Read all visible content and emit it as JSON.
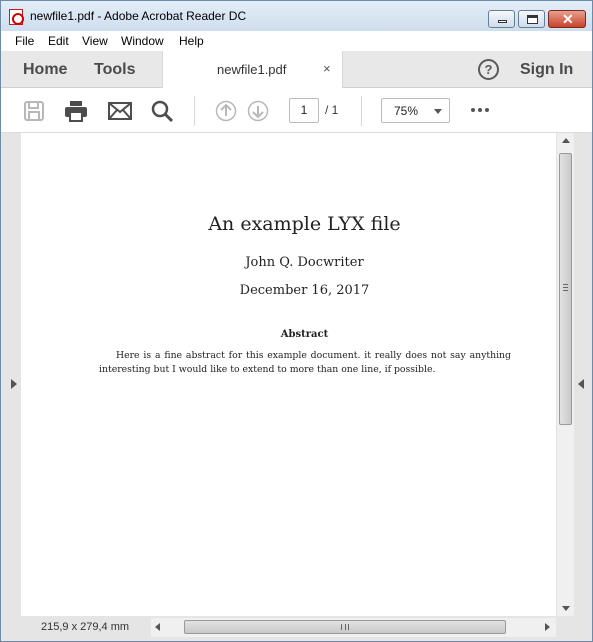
{
  "window": {
    "title": "newfile1.pdf - Adobe Acrobat Reader DC",
    "close_glyph": "✕"
  },
  "menu": [
    "File",
    "Edit",
    "View",
    "Window",
    "Help"
  ],
  "nav": {
    "home": "Home",
    "tools": "Tools",
    "tab_label": "newfile1.pdf",
    "tab_close": "×",
    "help_glyph": "?",
    "sign_in": "Sign In"
  },
  "toolbar": {
    "icons": [
      "save-icon",
      "print-icon",
      "email-icon",
      "search-icon",
      "previous-page-icon",
      "next-page-icon"
    ],
    "page_current": "1",
    "page_total": "/ 1",
    "zoom": "75%",
    "more_icon": "more-options-icon"
  },
  "document": {
    "title": "An example LYX file",
    "author": "John Q. Docwriter",
    "date": "December 16, 2017",
    "abstract_heading": "Abstract",
    "abstract_body": "Here is a fine abstract for this example document. it really does not say anything interesting but I would like to extend to more than one line, if possible."
  },
  "status": {
    "page_size": "215,9 x 279,4 mm"
  },
  "colors": {
    "titlebar": "#cfdeee",
    "tabbar": "#e8e8e8",
    "viewer_bg": "#e5e5e5",
    "close_button": "#c8432c"
  }
}
